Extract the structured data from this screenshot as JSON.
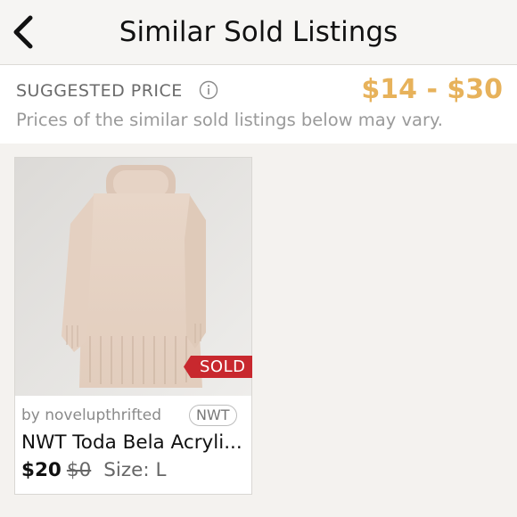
{
  "header": {
    "title": "Similar Sold Listings",
    "back_icon": "chevron-left-icon"
  },
  "suggested_price": {
    "label": "SUGGESTED PRICE",
    "info_icon": "info-icon",
    "range": "$14 - $30",
    "note": "Prices of the similar sold listings below may vary.",
    "range_color": "#e7b25b"
  },
  "listings": [
    {
      "image_description_icon": "sweater-photo",
      "sold_label": "SOLD",
      "seller": "by novelupthrifted",
      "condition": "NWT",
      "title": "NWT Toda Bela Acryli...",
      "price": "$20",
      "original_price": "$0",
      "size": "Size: L",
      "sold_color": "#c8282e"
    }
  ]
}
